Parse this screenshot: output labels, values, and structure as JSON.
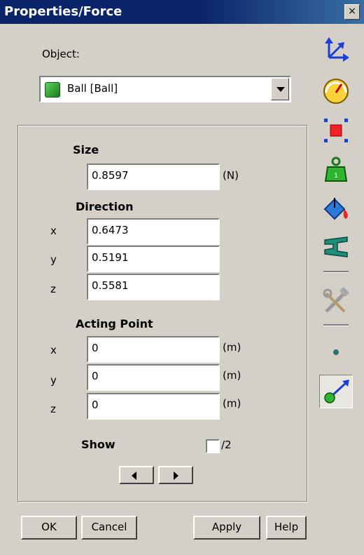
{
  "window": {
    "title": "Properties/Force",
    "close_glyph": "×"
  },
  "object": {
    "label": "Object:",
    "selected": "Ball   [Ball]"
  },
  "size": {
    "heading": "Size",
    "value": "0.8597",
    "unit": "(N)"
  },
  "direction": {
    "heading": "Direction",
    "x_label": "x",
    "x": "0.6473",
    "y_label": "y",
    "y": "0.5191",
    "z_label": "z",
    "z": "0.5581"
  },
  "acting_point": {
    "heading": "Acting Point",
    "x_label": "x",
    "x": "0",
    "x_unit": "(m)",
    "y_label": "y",
    "y": "0",
    "y_unit": "(m)",
    "z_label": "z",
    "z": "0",
    "z_unit": "(m)"
  },
  "show": {
    "label": "Show",
    "checkbox_text": "/2",
    "checked": false
  },
  "buttons": {
    "ok": "OK",
    "cancel": "Cancel",
    "apply": "Apply",
    "help": "Help"
  },
  "toolbar_icons": [
    "axes-icon",
    "gauge-icon",
    "select-box-icon",
    "mass-icon",
    "paint-bucket-icon",
    "beam-icon",
    "tools-icon",
    "point-icon",
    "force-vector-icon"
  ],
  "colors": {
    "title_bar": "#0a246a",
    "face": "#d4d0c8"
  }
}
